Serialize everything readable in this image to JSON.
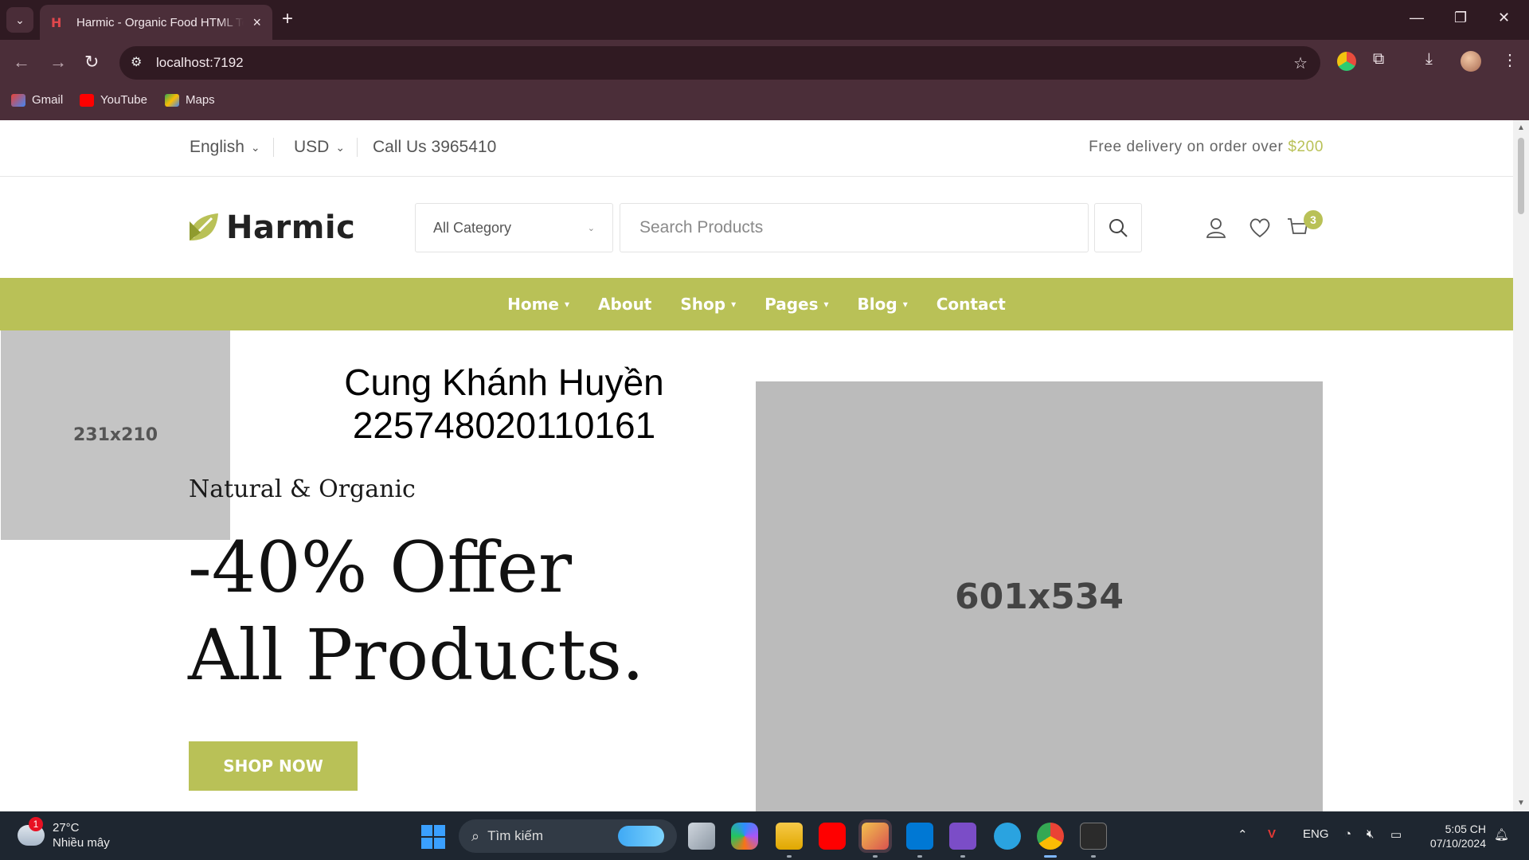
{
  "browser": {
    "tab_title": "Harmic - Organic Food HTML Te",
    "url": "localhost:7192",
    "bookmarks": [
      "Gmail",
      "YouTube",
      "Maps"
    ]
  },
  "topbar": {
    "language": "English",
    "currency": "USD",
    "phone": "Call Us 3965410",
    "delivery_text": "Free delivery on order over ",
    "delivery_amount": "$200"
  },
  "header": {
    "logo": "Harmic",
    "category_selected": "All Category",
    "search_placeholder": "Search Products",
    "cart_count": "3"
  },
  "nav": {
    "items": [
      "Home",
      "About",
      "Shop",
      "Pages",
      "Blog",
      "Contact"
    ]
  },
  "hero": {
    "small_placeholder": "231x210",
    "student_name": "Cung Khánh Huyền",
    "student_id": "2257480201101​61",
    "kicker": "Natural & Organic",
    "headline": "-40% Offer All Products.",
    "cta": "SHOP NOW",
    "big_placeholder": "601x534"
  },
  "taskbar": {
    "weather_badge": "1",
    "temperature": "27°C",
    "weather_desc": "Nhiều mây",
    "search_label": "Tìm kiếm",
    "language": "ENG",
    "time": "5:05 CH",
    "date": "07/10/2024"
  },
  "colors": {
    "accent": "#b9c157",
    "chrome": "#4b2e39",
    "taskbar": "#1e2630"
  }
}
